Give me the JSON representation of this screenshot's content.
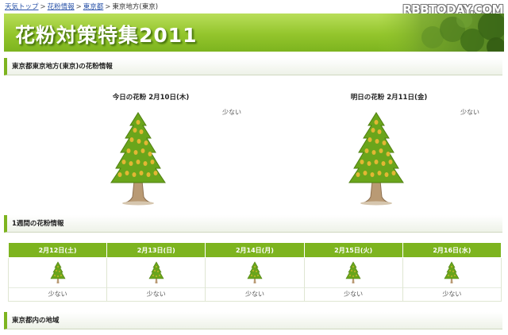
{
  "breadcrumb": {
    "items": [
      "天気トップ",
      "花粉情報",
      "東京都"
    ],
    "current": "東京地方(東京)",
    "separator": ">"
  },
  "watermark": "RBBTODAY.COM",
  "banner": {
    "title": "花粉対策特集2011"
  },
  "region_section": {
    "title": "東京都東京地方(東京)の花粉情報"
  },
  "today": {
    "title": "今日の花粉 2月10日(木)",
    "level": "少ない"
  },
  "tomorrow": {
    "title": "明日の花粉 2月11日(金)",
    "level": "少ない"
  },
  "week_section": {
    "title": "1週間の花粉情報",
    "days": [
      {
        "date": "2月12日(土)",
        "level": "少ない",
        "icon": "cedar-tree-icon"
      },
      {
        "date": "2月13日(日)",
        "level": "少ない",
        "icon": "cedar-tree-icon"
      },
      {
        "date": "2月14日(月)",
        "level": "少ない",
        "icon": "cedar-tree-icon"
      },
      {
        "date": "2月15日(火)",
        "level": "少ない",
        "icon": "cedar-tree-icon"
      },
      {
        "date": "2月16日(水)",
        "level": "少ない",
        "icon": "cedar-tree-icon"
      }
    ]
  },
  "areas_section": {
    "title": "東京都内の地域"
  },
  "colors": {
    "accent_green": "#7db41f",
    "banner_light": "#b9de5a",
    "tree_green": "#6aa51b",
    "pollen_yellow": "#e2b733",
    "trunk": "#b99a74",
    "link_blue": "#2a53a8"
  }
}
